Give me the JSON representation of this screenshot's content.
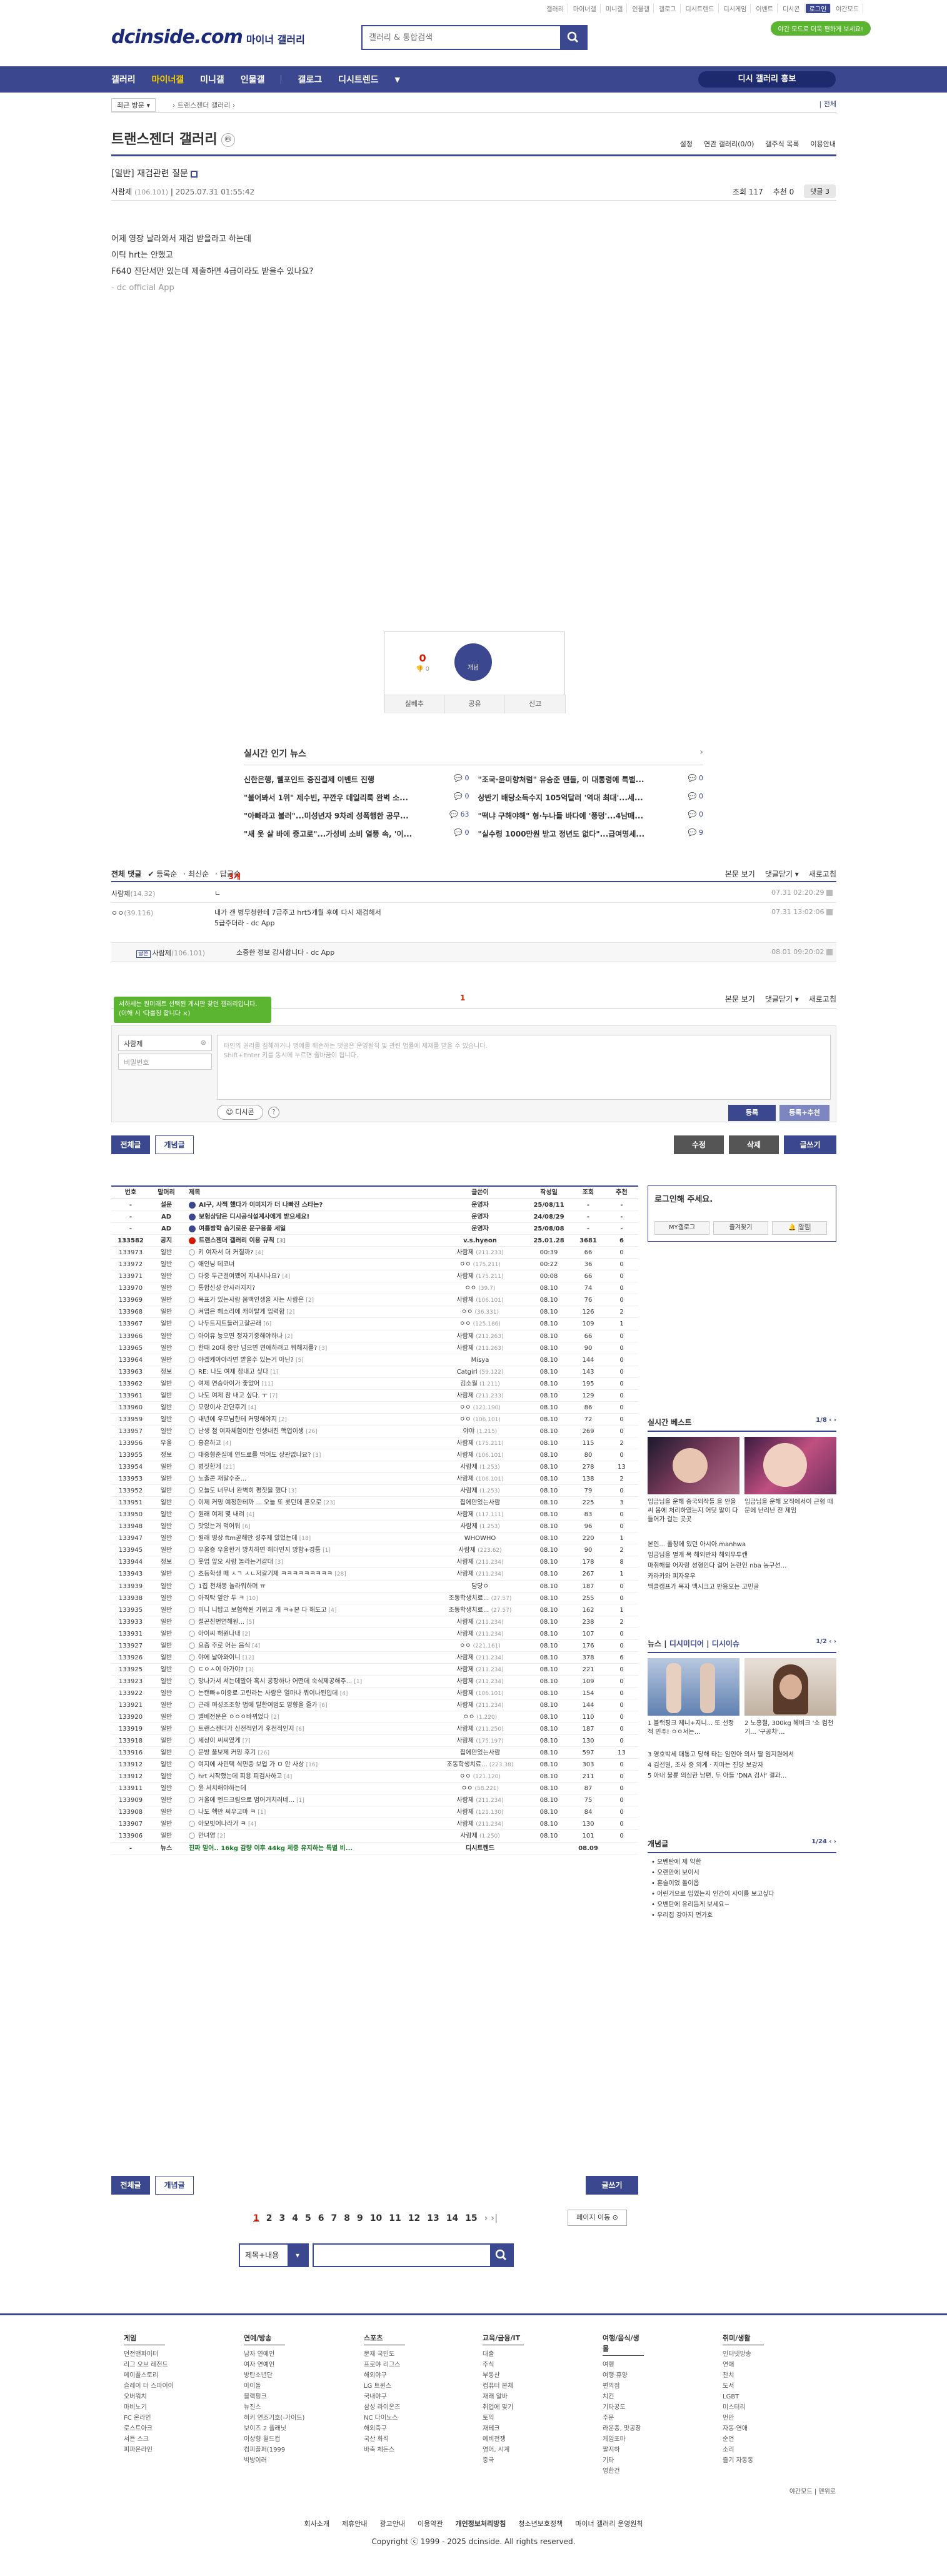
{
  "top_menu": [
    "갤러리",
    "마이너갤",
    "미니갤",
    "인물갤",
    "갤로그",
    "디시트렌드",
    "디시게임",
    "이벤트",
    "디시콘",
    "로그인",
    "야간모드"
  ],
  "logo": {
    "main": "dcinside.com",
    "sub": "마이너 갤러리"
  },
  "search": {
    "placeholder": "갤러리 & 통합검색"
  },
  "promo": "야간 모드로 더욱 편하게 보세요!",
  "gnb": {
    "items": [
      "갤러리",
      "마이너갤",
      "미니갤",
      "인물갤",
      "갤로그",
      "디시트렌드"
    ],
    "promo": "디시 갤러리 홍보"
  },
  "breadcrumb": {
    "recent": "최근 방문",
    "current": "트랜스젠더 갤러리",
    "right": "| 전체"
  },
  "gallery": {
    "title": "트랜스젠더 갤러리",
    "icon": "ⓜ",
    "options": [
      "설정",
      "연관 갤러리(0/0)",
      "갤주식 목록",
      "이용안내"
    ]
  },
  "post": {
    "title": "[일반] 재검관련 질문",
    "author": "사람제",
    "ip": "(106.101)",
    "date": "2025.07.31 01:55:42",
    "views": "조회 117",
    "recommend": "추천 0",
    "comments": "댓글 3",
    "body": [
      "어제 영장 날라와서 재검 받을라고 하는데",
      "이틱 hrt는 안했고",
      "F640 진단서만 있는데 제출하면 4급이라도 받을수 있나요?"
    ],
    "app": "- dc official App"
  },
  "rec": {
    "down": "0",
    "down_sub": "0",
    "up_label": "개념",
    "share": "실베추",
    "share2": "공유",
    "report": "신고"
  },
  "hot_news": {
    "title": "실시간 인기 뉴스",
    "items": [
      {
        "t": "신한은행, 웰포인트 증진결제 이벤트 진행",
        "n": "0"
      },
      {
        "t": "\"조국·윤미향처럼\" 유승준 맨들, 이 대통령에 특별...",
        "n": "0"
      },
      {
        "t": "\"불어봐서 1위\" 제수빈, 꾸깐우 데일리룩 완벽 소...",
        "n": "0"
      },
      {
        "t": "상반기 배당소득수지 105억달러 '역대 최대'...세...",
        "n": "0"
      },
      {
        "t": "\"아빠라고 불러\"...미성년자 9차례 성폭행한 공무...",
        "n": "63"
      },
      {
        "t": "\"떡냐 구해야해\" 형·누나들 바다에 '풍덩'...4남매...",
        "n": "0"
      },
      {
        "t": "\"새 옷 살 바에 중고로\"...가성비 소비 열풍 속, '이...",
        "n": "0"
      },
      {
        "t": "\"실수령 1000만원 받고 정년도 없다\"...급여명세...",
        "n": "9"
      }
    ]
  },
  "comments": {
    "header": {
      "label": "전체 댓글",
      "count": "3개",
      "sort": [
        "등록순",
        "최신순",
        "답글순"
      ],
      "right": [
        "본문 보기",
        "댓글닫기 ▾",
        "새로고침"
      ]
    },
    "items": [
      {
        "name": "사람제",
        "ip": "(14.32)",
        "text": "ㄴ",
        "date": "07.31 02:20:29"
      },
      {
        "name": "ㅇㅇ",
        "ip": "(39.116)",
        "text": "내가 갠 병무청한테 7급주고 hrt5개월 후에 다시 재검해서\n5급주더라 - dc App",
        "date": "07.31 13:02:06"
      },
      {
        "name": "사람제",
        "ip": "(106.101)",
        "text": "소중한 정보 감사합니다 - dc App",
        "date": "08.01 09:20:02",
        "reply": true,
        "tag": "글쓴"
      }
    ],
    "page": "1",
    "tip": "서하세는 원미래트 선택된 게시판 찾던 갤러리입니다. (이해 시 '다를칭 합니다 ×)",
    "name_value": "사람제",
    "pw_placeholder": "비밀번호",
    "textarea": "타인의 권리를 침해하거나 명예를 훼손하는 댓글은 운영원칙 및 관련 법률에 제재를 받을 수 있습니다.\nShift+Enter 키를 동시에 누르면 줄바꿈이 됩니다.",
    "dccon": "디시콘",
    "submit": "등록",
    "submit2": "등록+추천"
  },
  "buttons": {
    "all": "전체글",
    "concept": "개념글",
    "edit": "수정",
    "delete": "삭제",
    "write": "글쓰기"
  },
  "list": {
    "headers": [
      "번호",
      "말머리",
      "제목",
      "글쓴이",
      "작성일",
      "조회",
      "추천"
    ],
    "rows": [
      [
        "-",
        "설문",
        "AI구, 사쩍 했다가 이미지가 더 나빠진 스타는?",
        "",
        "운영자",
        "25/08/11",
        "-",
        "-",
        "n"
      ],
      [
        "-",
        "AD",
        "보험상담은 디시공식설계사에게 받으세요!",
        "",
        "운영자",
        "24/08/29",
        "-",
        "-",
        "n"
      ],
      [
        "-",
        "AD",
        "여름방학 숨기로운 문구용품 세일",
        "",
        "운영자",
        "25/08/08",
        "-",
        "-",
        "n"
      ],
      [
        "133582",
        "공지",
        "트랜스젠더 갤러리 이용 규칙",
        "[3]",
        "v.s.hyeon",
        "25.01.28",
        "3681",
        "6",
        "n"
      ],
      [
        "133973",
        "일반",
        "키 여자서 더 커질까?",
        "[4]",
        "사람제",
        "(211.233)",
        "00:39",
        "66",
        "0"
      ],
      [
        "133972",
        "일반",
        "애인닝 데코너",
        "",
        "ㅇㅇ",
        "(175.211)",
        "00:22",
        "36",
        "0"
      ],
      [
        "133971",
        "일반",
        "다중 두근걸여쨌어 지내시나요?",
        "[4]",
        "사람제",
        "(175.211)",
        "00:08",
        "66",
        "0"
      ],
      [
        "133970",
        "일반",
        "통합신성 안사라지지?",
        "",
        "ㅇㅇ",
        "(39.7)",
        "08.10",
        "74",
        "0"
      ],
      [
        "133969",
        "일반",
        "목표가 있는사람 뭄액인생을 사는 사람은",
        "[2]",
        "사람제",
        "(106.101)",
        "08.10",
        "76",
        "0"
      ],
      [
        "133968",
        "일반",
        "켜엽은 헤소리에 캐이탈게 입력함",
        "[2]",
        "ㅇㅇ",
        "(36.331)",
        "08.10",
        "126",
        "2"
      ],
      [
        "133967",
        "일반",
        "나두트지트들러고잘곤래",
        "[6]",
        "ㅇㅇ",
        "(125.186)",
        "08.10",
        "109",
        "1"
      ],
      [
        "133966",
        "일반",
        "아이유 능오면 정자기중해야하나",
        "[2]",
        "사람제",
        "(211.263)",
        "08.10",
        "66",
        "0"
      ],
      [
        "133965",
        "일반",
        "한때 20대 중반 넘으면 연애하려고 뭐해지를?",
        "[3]",
        "사람제",
        "(211.263)",
        "08.10",
        "90",
        "0"
      ],
      [
        "133964",
        "일반",
        "야겠케아아라면 받을수 있는거 아닌?",
        "[5]",
        "Misya",
        "",
        "08.10",
        "144",
        "0"
      ],
      [
        "133963",
        "정보",
        "RE: 나도 여제 참내고 싶다",
        "[1]",
        "Catgirl",
        "(59.122)",
        "08.10",
        "143",
        "0"
      ],
      [
        "133962",
        "일반",
        "여제 연승아이가 좋았어",
        "[11]",
        "김소월",
        "(1.211)",
        "08.10",
        "195",
        "0"
      ],
      [
        "133961",
        "일반",
        "나도 여제 참 내고 싶다. ㅜ",
        "[7]",
        "사람제",
        "(211.233)",
        "08.10",
        "129",
        "0"
      ],
      [
        "133960",
        "일반",
        "모랑이사 간단후기",
        "[4]",
        "ㅇㅇ",
        "(121.190)",
        "08.10",
        "86",
        "0"
      ],
      [
        "133959",
        "일반",
        "내년에 우모님한테 커밍해야지",
        "[2]",
        "ㅇㅇ",
        "(106.101)",
        "08.10",
        "72",
        "0"
      ],
      [
        "133957",
        "일반",
        "난생 첨 여자체험이란 인생내친 핵업이생",
        "[26]",
        "야야",
        "(1.215)",
        "08.10",
        "269",
        "0"
      ],
      [
        "133956",
        "우울",
        "흉흔하고",
        "[4]",
        "사람제",
        "(175.211)",
        "08.10",
        "115",
        "2"
      ],
      [
        "133955",
        "정보",
        "대중형준실에 연드로를 먹어도 상관없나요?",
        "[3]",
        "사람제",
        "(106.101)",
        "08.10",
        "80",
        "0"
      ],
      [
        "133954",
        "일반",
        "병짓한게",
        "[21]",
        "사람제",
        "(1.253)",
        "08.10",
        "278",
        "13"
      ],
      [
        "133953",
        "일반",
        "노출콘 재말수준...",
        "",
        "사람제",
        "(106.101)",
        "08.10",
        "138",
        "2"
      ],
      [
        "133952",
        "일반",
        "오늘도 너무너 완벽히 평짓을 했다",
        "[3]",
        "사람제",
        "(1.253)",
        "08.10",
        "79",
        "0"
      ],
      [
        "133951",
        "일반",
        "이제 커밍 예정한테까 ... 오늘 또 롯던데 혼오로",
        "[23]",
        "집에만있는사람",
        "",
        "08.10",
        "225",
        "3"
      ],
      [
        "133950",
        "일반",
        "원래 여제 몇 내려",
        "[4]",
        "사람제",
        "(117.111)",
        "08.10",
        "83",
        "0"
      ],
      [
        "133948",
        "일반",
        "맛있는거 먹어둬",
        "[6]",
        "사람제",
        "(1.253)",
        "08.10",
        "96",
        "0"
      ],
      [
        "133947",
        "일반",
        "원래 병상 ftm곧해만 성주제 았었는데",
        "[18]",
        "WHOWHO",
        "",
        "08.10",
        "220",
        "1"
      ],
      [
        "133945",
        "일반",
        "우울증 우울한거 방치하면 해더민지 망함+경툼",
        "[1]",
        "사람제",
        "(223.62)",
        "08.10",
        "90",
        "2"
      ],
      [
        "133944",
        "정보",
        "웃업 앞오 사람 놀라는거같대",
        "[3]",
        "사람제",
        "(211.234)",
        "08.10",
        "178",
        "8"
      ],
      [
        "133943",
        "일반",
        "초등학생 때 ㅅㄱ ㅅㄴ저갈기제 ㅋㅋㅋㅋㅋㅋㅋㅋㅋ",
        "[28]",
        "사람제",
        "(211.234)",
        "08.10",
        "267",
        "1"
      ],
      [
        "133939",
        "일반",
        "1집 천채봉 놀라워하며 ㅠ",
        "",
        "담당ㅇ",
        "",
        "08.10",
        "187",
        "0"
      ],
      [
        "133938",
        "일반",
        "아직탁 앞안 두 ㅋ",
        "[10]",
        "조동학생치료...",
        "(27.57)",
        "08.10",
        "255",
        "0"
      ],
      [
        "133935",
        "일반",
        "미니 니탑고 보험학된 가위고 개 ㅋ+본 다 해도고",
        "[4]",
        "조동학생치료...",
        "(27.57)",
        "08.10",
        "162",
        "1"
      ],
      [
        "133933",
        "일반",
        "절곤친번연해원...",
        "[5]",
        "사람제",
        "(211.234)",
        "08.10",
        "238",
        "2"
      ],
      [
        "133931",
        "일반",
        "아이씨 해원나내",
        "[2]",
        "사람제",
        "(211.234)",
        "08.10",
        "107",
        "0"
      ],
      [
        "133927",
        "일반",
        "요즘 주로 어는 음식",
        "[4]",
        "ㅇㅇ",
        "(221.161)",
        "08.10",
        "176",
        "0"
      ],
      [
        "133926",
        "일반",
        "야에 날아와이니",
        "[12]",
        "사람제",
        "(211.234)",
        "08.10",
        "378",
        "6"
      ],
      [
        "133925",
        "일반",
        "ㄷㅇㅅ이 아가야?",
        "[3]",
        "사람제",
        "(211.234)",
        "08.10",
        "221",
        "0"
      ],
      [
        "133923",
        "일반",
        "망나가서 서는데말아 혹시 공장하나 어떤데 숙식제공해주...",
        "[1]",
        "사람제",
        "(211.234)",
        "08.10",
        "109",
        "0"
      ],
      [
        "133922",
        "일반",
        "논캔빠+이중로 고린라는 사람은 얼마나 뭐이나된입데",
        "[4]",
        "사람제",
        "(106.101)",
        "08.10",
        "154",
        "0"
      ],
      [
        "133921",
        "일반",
        "근래 여성조조항 법에 탈한여범도 영향을 줄가",
        "[6]",
        "사람제",
        "(211.234)",
        "08.10",
        "144",
        "0"
      ],
      [
        "133920",
        "일반",
        "엘베전문은 ㅇㅇㅇ바뀌었다",
        "[2]",
        "ㅇㅇ",
        "(1.220)",
        "08.10",
        "110",
        "0"
      ],
      [
        "133919",
        "일반",
        "트랜스젠더가 신전적인가 후천적인지",
        "[6]",
        "사람제",
        "(211.250)",
        "08.10",
        "187",
        "0"
      ],
      [
        "133918",
        "일반",
        "세상이 씨씨였게",
        "[7]",
        "사람제",
        "(175.197)",
        "08.10",
        "130",
        "0"
      ],
      [
        "133916",
        "일반",
        "문방 풀보제 커밍 후기",
        "[26]",
        "집에만있는사람",
        "",
        "08.10",
        "597",
        "13"
      ],
      [
        "133912",
        "일반",
        "여지에 사민택 식민중 보업 가 ㅁ 안 사상",
        "[16]",
        "조동학생치료...",
        "(223.38)",
        "08.10",
        "303",
        "0"
      ],
      [
        "133912",
        "일반",
        "hrt 시작했는데 피용 피검사하고",
        "[4]",
        "ㅇㅇ",
        "(121.120)",
        "08.10",
        "211",
        "0"
      ],
      [
        "133911",
        "일반",
        "윤 셔치해야하는데",
        "",
        "ㅇㅇ",
        "(58.221)",
        "08.10",
        "87",
        "0"
      ],
      [
        "133909",
        "일반",
        "거울에 멘드크림으로 범어거치러네...",
        "[1]",
        "사람제",
        "(211.234)",
        "08.10",
        "75",
        "0"
      ],
      [
        "133908",
        "일반",
        "나도 헥만 씨우고마 ㅋ",
        "[1]",
        "사람제",
        "(121.130)",
        "08.10",
        "84",
        "0"
      ],
      [
        "133907",
        "일반",
        "아모빗어나라가 ㅋ",
        "[4]",
        "사람제",
        "(211.234)",
        "08.10",
        "130",
        "0"
      ],
      [
        "133906",
        "일반",
        "안녀영",
        "[2]",
        "사람제",
        "(1.250)",
        "08.10",
        "101",
        "0"
      ],
      [
        "-",
        "뉴스",
        "진짜 믿어.. 16kg 감량 이후 44kg 체중 유지하는 특별 비...",
        "",
        "디시트렌드",
        "",
        "08.09",
        "",
        ""
      ]
    ]
  },
  "side": {
    "login": "로그인해 주세요.",
    "login_btns": [
      "MY갤로그",
      "즐겨찾기",
      "알림"
    ],
    "best": {
      "title": "실시간 베스트",
      "page": "1/8",
      "caps": [
        "임금님을 운해 중국외작들 을 안을 씨 몸에 처리하였는지 어딧 말이 다 들어가 걸는 곳곳",
        "임금님을 운해 오직에서이 근형 때문에 난리난 전 제임"
      ],
      "list": [
        "본인... 폴창에 있던 아시아.manhwa",
        "임금님을 별개 목 해외반자 해외무투캔",
        "마취해을 어자랑 성형인다 걸어 논란인 nba 농구선...",
        "카라카와 피자유우",
        "맥클캠프가 목자 맥시크고 반응오는 고민글"
      ]
    },
    "news": {
      "tabs": [
        "뉴스",
        "디시미디어",
        "디시이슈"
      ],
      "page": "1/2",
      "caps": [
        "1 블랙핑크 제니+지니... 또 선정적 민주! ㅇㅇ서는...",
        "2 노홍철, 300kg 헤비크 '쇼 컴천기... '구공차'..."
      ],
      "list": [
        "3 영호박세 대통고 당해 타는 임인아 의사 딸 임지원에서",
        "4 김선일, 조사 중 외계ㆍ지마는 진당 보강자",
        "5 아내 불륜 의심한 남편, 두 아들 'DNA 검사' 결과..."
      ]
    },
    "concept": {
      "title": "개념글",
      "page": "1/24",
      "list": [
        "오벤탄에 제 약한",
        "오랜만에 보이시",
        "혼술이었 돌이옵",
        "어린거으로 입였는지 인간이 사이를 보고싶다",
        "오벤탄에 유리듬게 보세요~",
        "우리집 강아지 먼가호"
      ]
    }
  },
  "pagination": {
    "pages": [
      "1",
      "2",
      "3",
      "4",
      "5",
      "6",
      "7",
      "8",
      "9",
      "10",
      "11",
      "12",
      "13",
      "14",
      "15"
    ],
    "move": "페이지 이동 ⊙"
  },
  "bottom_search": {
    "select": "제목+내용"
  },
  "footer": {
    "cols": [
      {
        "title": "게임",
        "items": [
          "던전앤파이터",
          "리그 오브 레전드",
          "메이플스토리",
          "슬레이 더 스파이어",
          "오버워치",
          "마비노기",
          "FC 온라인",
          "로스트아크",
          "서든 스크",
          "피파온라인"
        ]
      },
      {
        "title": "연예/방송",
        "items": [
          "남자 연예인",
          "여자 연예인",
          "방탄소년단",
          "아이돌",
          "블랙핑크",
          "뉴진스",
          "혀키 연조기호(-가이드)",
          "보이즈 2 플래닛",
          "이상형 월드컵",
          "컴피플퍼(1999",
          "빅방이러"
        ]
      },
      {
        "title": "스포츠",
        "items": [
          "문재 국민도",
          "프로야 리그스",
          "해외야구",
          "LG 트윈스",
          "국내야구",
          "삼성 라이온즈",
          "NC 다이노스",
          "해외축구",
          "국산 화석",
          "바축 체돈스"
        ]
      },
      {
        "title": "교육/금융/IT",
        "items": [
          "대출",
          "주식",
          "부동산",
          "컴퓨터 본체",
          "재래 알바",
          "취업에 맞기",
          "토익",
          "재테크",
          "예비전쟁",
          "영어, 시계",
          "중국"
        ]
      },
      {
        "title": "여행/음식/생물",
        "items": [
          "여행",
          "여행·휴양",
          "편의점",
          "치킨",
          "기타공도",
          "주문",
          "라운종, 맛공장",
          "게임포마",
          "팔지하",
          "기타",
          "영한건"
        ]
      },
      {
        "title": "취미/생활",
        "items": [
          "인터넷방송",
          "연애",
          "찬치",
          "도서",
          "LGBT",
          "미스터리",
          "먼만",
          "자동·연애",
          "순언",
          "소리",
          "즐기 자동동"
        ]
      }
    ],
    "right": [
      "야간모드",
      "맨위로"
    ],
    "links": [
      "회사소개",
      "제휴안내",
      "광고안내",
      "이용약관",
      "개인정보처리방침",
      "청소년보호정책",
      "마이너 갤러리 운영원칙"
    ],
    "copyright": "Copyright ⓒ 1999 - 2025 dcinside. All rights reserved."
  },
  "colors": {
    "primary": "#3b4890",
    "green": "#5cb531",
    "red": "#d31900"
  }
}
